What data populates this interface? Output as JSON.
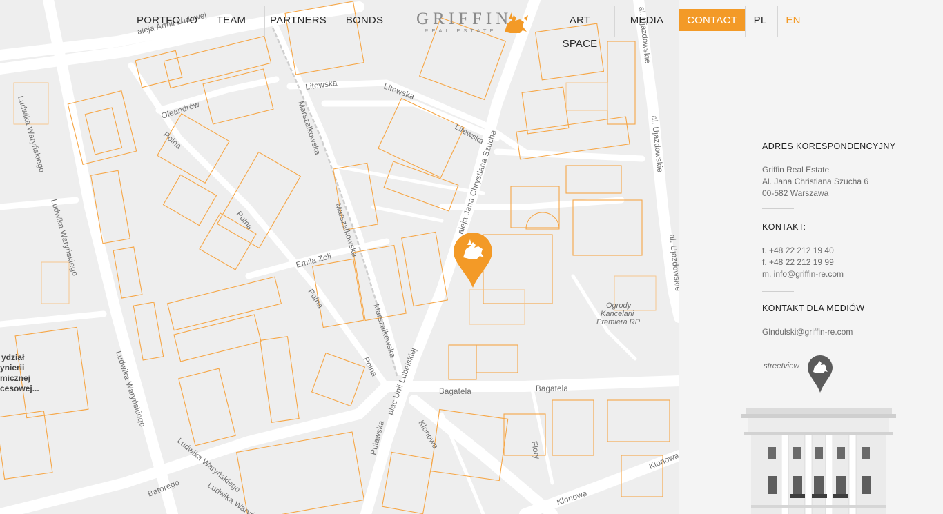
{
  "nav": {
    "left_items": [
      "PORTFOLIO",
      "TEAM",
      "PARTNERS",
      "BONDS"
    ],
    "right_items": [
      "ART SPACE",
      "MEDIA",
      "CONTACT"
    ],
    "langs": [
      "PL",
      "EN"
    ],
    "active_item": "CONTACT",
    "active_lang": "EN",
    "accent_color": "#f39a27"
  },
  "logo": {
    "word": "GRIFFIN",
    "sub": "REAL ESTATE",
    "icon": "griffin-icon"
  },
  "map": {
    "streets": {
      "aleja_ludowej": "aleja Armii Ludowej",
      "litewska": "Litewska",
      "oleandrow": "Oleandrów",
      "polna": "Polna",
      "marszalkowska": "Marszałkowska",
      "szucha": "aleja Jana Chrystiana Szucha",
      "emila_zoli": "Emila Zoli",
      "ujazdowskie": "al. Ujazdowskie",
      "warynskiego": "Ludwika Waryńskiego",
      "bagatela": "Bagatela",
      "pulawska": "Puławska",
      "plac_unii": "plac Unii Lubelskiej",
      "klonowa": "Klonowa",
      "flory": "Flory",
      "batorego": "Batorego"
    },
    "areas": {
      "ogrody_1": "Ogrody",
      "ogrody_2": "Kancelarii",
      "ogrody_3": "Premiera RP",
      "wydzial_1": "ydział",
      "wydzial_2": "ynierii",
      "wydzial_3": "micznej",
      "wydzial_4": "cesowej..."
    },
    "marker_icon": "griffin-icon",
    "building_color": "#f6a646"
  },
  "contact": {
    "address_heading": "ADRES KORESPONDENCYJNY",
    "address_lines": [
      "Griffin Real Estate",
      "Al. Jana Christiana Szucha 6",
      "00-582 Warszawa"
    ],
    "contact_heading": "KONTAKT:",
    "contact_lines": [
      "t. +48 22 212 19 40",
      "f. +48 22 212 19 99",
      "m.  info@griffin-re.com"
    ],
    "media_heading": "KONTAKT DLA MEDIÓW",
    "media_email": "Glndulski@griffin-re.com",
    "streetview_label": "streetview"
  }
}
